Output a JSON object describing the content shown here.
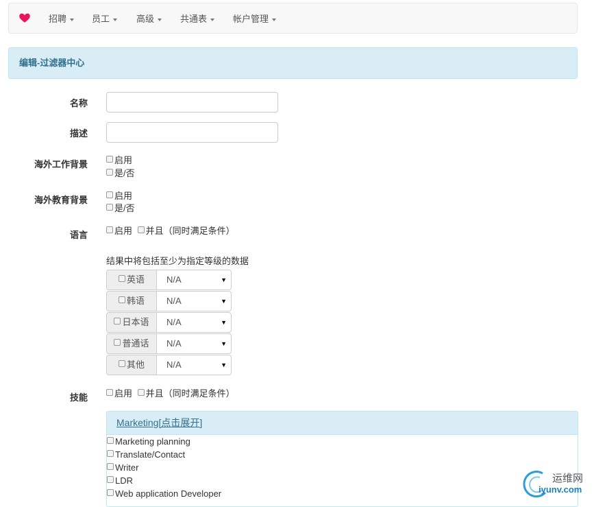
{
  "nav": {
    "items": [
      {
        "label": "招聘"
      },
      {
        "label": "员工"
      },
      {
        "label": "高级"
      },
      {
        "label": "共通表"
      },
      {
        "label": "帐户管理"
      }
    ]
  },
  "panel": {
    "title": "编辑-过滤器中心"
  },
  "form": {
    "name_label": "名称",
    "name_value": "",
    "desc_label": "描述",
    "desc_value": "",
    "overseas_work": {
      "label": "海外工作背景",
      "enable": "启用",
      "yes_no": "是/否"
    },
    "overseas_edu": {
      "label": "海外教育背景",
      "enable": "启用",
      "yes_no": "是/否"
    },
    "language": {
      "label": "语言",
      "enable": "启用",
      "and": "并且（同时满足条件）",
      "note": "结果中将包括至少为指定等级的数据",
      "rows": [
        {
          "name": "英语",
          "value": "N/A"
        },
        {
          "name": "韩语",
          "value": "N/A"
        },
        {
          "name": "日本语",
          "value": "N/A"
        },
        {
          "name": "普通话",
          "value": "N/A"
        },
        {
          "name": "其他",
          "value": "N/A"
        }
      ]
    },
    "skills": {
      "label": "技能",
      "enable": "启用",
      "and": "并且（同时满足条件）",
      "group_title": "Marketing[点击展开]",
      "items": [
        "Marketing planning",
        "Translate/Contact",
        "Writer",
        "LDR",
        "Web application Developer"
      ]
    }
  },
  "watermark": {
    "cn": "运维网",
    "en": "iyunv.com"
  },
  "colors": {
    "heart": "#e8175d",
    "panel_bg": "#d9edf7",
    "panel_text": "#31708f"
  }
}
